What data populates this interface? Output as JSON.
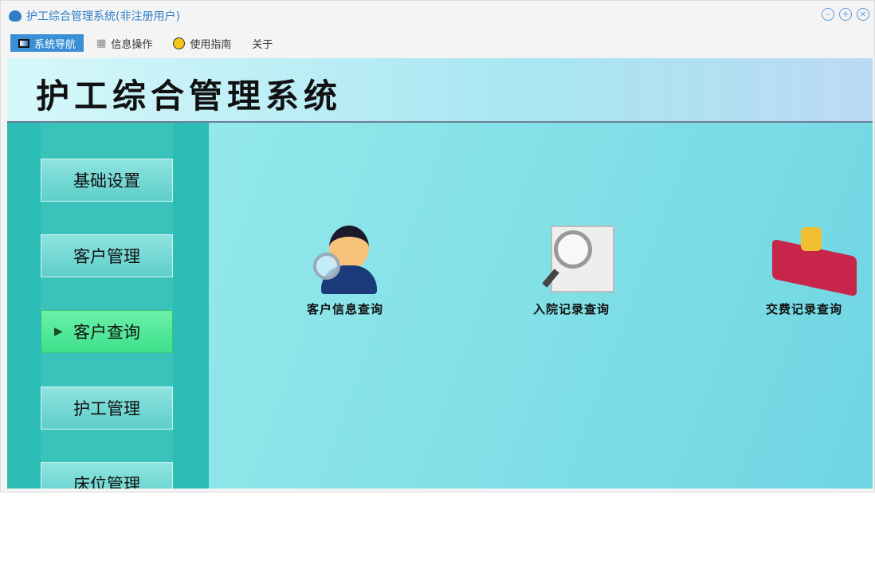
{
  "window": {
    "title": "护工综合管理系统(非注册用户)"
  },
  "menu": [
    {
      "label": "系统导航",
      "icon": "monitor-icon"
    },
    {
      "label": "信息操作",
      "icon": "grid-icon"
    },
    {
      "label": "使用指南",
      "icon": "help-icon"
    },
    {
      "label": "关于"
    }
  ],
  "banner": {
    "title": "护工综合管理系统"
  },
  "sidebar": [
    {
      "label": "基础设置"
    },
    {
      "label": "客户管理"
    },
    {
      "label": "客户查询",
      "active": true
    },
    {
      "label": "护工管理"
    },
    {
      "label": "床位管理"
    }
  ],
  "functions": [
    {
      "label": "客户信息查询",
      "icon": "user-search-icon"
    },
    {
      "label": "入院记录查询",
      "icon": "document-search-icon"
    },
    {
      "label": "交费记录查询",
      "icon": "payment-book-icon"
    }
  ],
  "colors": {
    "accent": "#3a8fd6",
    "active": "#3ee08c",
    "sidebar": "#2bbdb6"
  }
}
